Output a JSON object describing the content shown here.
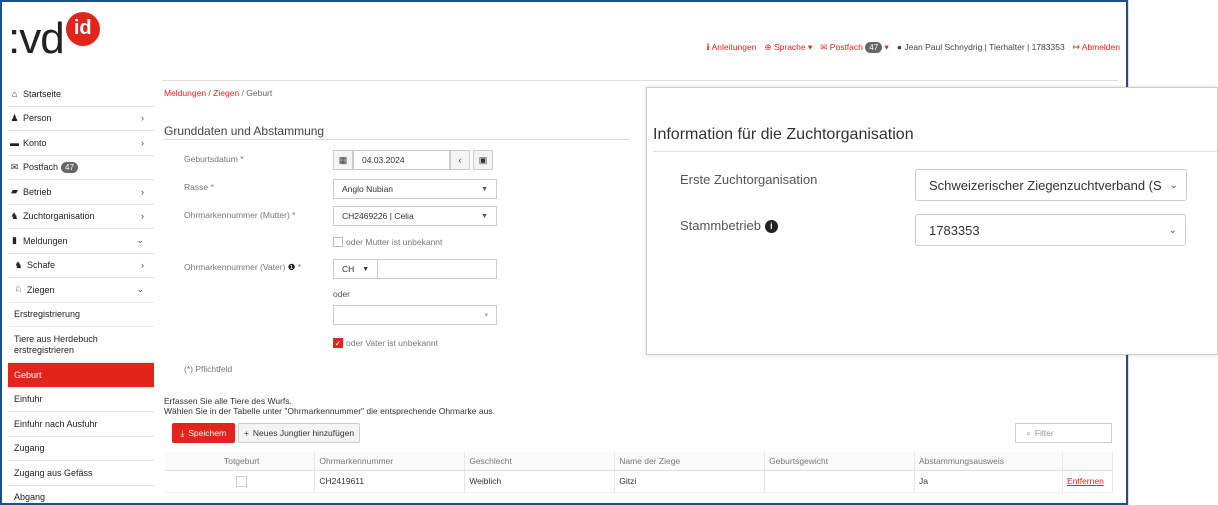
{
  "logo": {
    "text": ":vd",
    "id": "id"
  },
  "topnav": {
    "instructions": "Anleitungen",
    "language": "Sprache",
    "mailbox": "Postfach",
    "mailbox_count": "47",
    "user": "Jean Paul Schnydrig | Tierhalter | 1783353",
    "logout": "Abmelden"
  },
  "sidebar": {
    "items": [
      {
        "label": "Startseite"
      },
      {
        "label": "Person"
      },
      {
        "label": "Konto"
      },
      {
        "label": "Postfach",
        "badge": "47"
      },
      {
        "label": "Betrieb"
      },
      {
        "label": "Zuchtorganisation"
      },
      {
        "label": "Meldungen"
      },
      {
        "label": "Schafe"
      },
      {
        "label": "Ziegen"
      }
    ],
    "subitems": [
      "Erstregistrierung",
      "Tiere aus Herdebuch erstregistrieren",
      "Geburt",
      "Einfuhr",
      "Einfuhr nach Ausfuhr",
      "Zugang",
      "Zugang aus Gefäss",
      "Abgang"
    ]
  },
  "breadcrumb": {
    "part1": "Meldungen",
    "part2": "Ziegen",
    "part3": "Geburt"
  },
  "form": {
    "section_title": "Grunddaten und Abstammung",
    "birth_date_label": "Geburtsdatum *",
    "birth_date_value": "04.03.2024",
    "breed_label": "Rasse *",
    "breed_value": "Anglo Nubian",
    "mother_label": "Ohrmarkennummer (Mutter) *",
    "mother_value": "CH2469226 | Celia",
    "mother_unknown": "oder Mutter ist unbekannt",
    "father_label": "Ohrmarkennummer (Vater)",
    "father_country": "CH",
    "or_label": "oder",
    "father_unknown": "oder Vater ist unbekannt",
    "required_note": "(*) Pflichtfeld"
  },
  "intro": {
    "line1": "Erfassen Sie alle Tiere des Wurfs.",
    "line2": "Wählen Sie in der Tabelle unter \"Ohrmarkennummer\" die entsprechende Ohrmarke aus."
  },
  "toolbar": {
    "save_label": "Speichern",
    "add_label": "Neues Jungtier hinzufügen",
    "filter_placeholder": "Filter"
  },
  "table": {
    "columns": [
      "Totgeburt",
      "Ohrmarkennummer",
      "Geschlecht",
      "Name der Ziege",
      "Geburtsgewicht",
      "Abstammungsausweis",
      ""
    ],
    "rows": [
      {
        "stillbirth": "",
        "eartag": "CH2419611",
        "sex": "Weiblich",
        "name": "Gitzi",
        "weight": "",
        "pedigree": "Ja",
        "action": "Entfernen"
      }
    ]
  },
  "card": {
    "title": "Information für die Zuchtorganisation",
    "org_label": "Erste Zuchtorganisation",
    "org_value": "Schweizerischer Ziegenzuchtverband (S",
    "farm_label": "Stammbetrieb",
    "farm_value": "1783353"
  },
  "colors": {
    "accent": "#e1251b",
    "frame": "#1d4f8b"
  }
}
